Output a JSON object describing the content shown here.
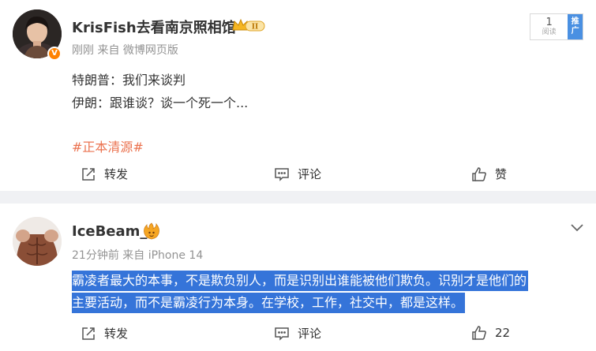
{
  "post": {
    "author": "KrisFish去看南京照相馆",
    "badge_level": "II",
    "meta": "刚刚 来自 微博网页版",
    "lines": [
      "特朗普：我们来谈判",
      "伊朗：跟谁谈？谈一个死一个..."
    ],
    "hashtag": "#正本清源#",
    "read_count": "1",
    "read_label": "阅读",
    "promo_label": [
      "推",
      "广"
    ],
    "actions": {
      "repost": "转发",
      "comment": "评论",
      "like": "赞"
    }
  },
  "comment": {
    "author": "IceBeam_",
    "meta": "21分钟前 来自 iPhone 14",
    "lines": [
      "霸凌者最大的本事，不是欺负别人，而是识别出谁能被他们欺负。识别才是他们的",
      "主要活动，而不是霸凌行为本身。在学校，工作，社交中，都是这样。"
    ],
    "actions": {
      "repost": "转发",
      "comment": "评论",
      "like": "22"
    }
  },
  "colors": {
    "accent": "#ff8200",
    "hashtag": "#eb7350",
    "selection": "#3574d9",
    "link_blue": "#4a90e2"
  },
  "icons": [
    "verified-icon",
    "crown-badge-icon",
    "repost-icon",
    "comment-icon",
    "like-icon",
    "chevron-down-icon",
    "flame-badge-icon"
  ]
}
